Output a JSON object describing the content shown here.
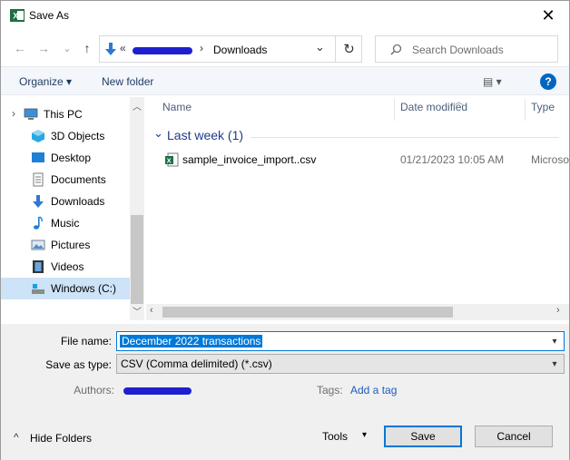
{
  "window": {
    "title": "Save As",
    "close_glyph": "✕",
    "app_icon": "excel-icon"
  },
  "nav_buttons": {
    "back": "←",
    "forward": "→",
    "recent": "⌄",
    "up": "↑"
  },
  "address": {
    "prefix": "«",
    "current_folder": "Downloads",
    "separator": "›",
    "refresh_glyph": "↻",
    "chevron": "⌄"
  },
  "search": {
    "placeholder": "Search Downloads"
  },
  "toolbar": {
    "organize": "Organize ▾",
    "new_folder": "New folder",
    "view_glyph": "▤ ▾",
    "help": "?"
  },
  "sidebar": {
    "items": [
      {
        "label": "This PC",
        "icon": "pc-icon",
        "indent": 0
      },
      {
        "label": "3D Objects",
        "icon": "cube-icon",
        "indent": 1
      },
      {
        "label": "Desktop",
        "icon": "desktop-icon",
        "indent": 1
      },
      {
        "label": "Documents",
        "icon": "document-icon",
        "indent": 1
      },
      {
        "label": "Downloads",
        "icon": "download-icon",
        "indent": 1
      },
      {
        "label": "Music",
        "icon": "music-icon",
        "indent": 1
      },
      {
        "label": "Pictures",
        "icon": "picture-icon",
        "indent": 1
      },
      {
        "label": "Videos",
        "icon": "video-icon",
        "indent": 1
      },
      {
        "label": "Windows (C:)",
        "icon": "drive-icon",
        "indent": 1,
        "selected": true
      }
    ],
    "expand_glyph": "›"
  },
  "columns": [
    "Name",
    "Date modified",
    "Type"
  ],
  "group": {
    "label": "Last week (1)",
    "collapse_glyph": "⌄"
  },
  "files": [
    {
      "name": "sample_invoice_import..csv",
      "date": "01/21/2023 10:05 AM",
      "type": "Microso",
      "icon": "excel-csv-icon"
    }
  ],
  "form": {
    "file_name_label": "File name:",
    "file_name_value": "December 2022 transactions",
    "save_type_label": "Save as type:",
    "save_type_value": "CSV (Comma delimited) (*.csv)",
    "authors_label": "Authors:",
    "tags_label": "Tags:",
    "tags_placeholder": "Add a tag"
  },
  "footer": {
    "hide_folders": "Hide Folders",
    "hide_glyph": "^",
    "tools": "Tools",
    "tools_glyph": "▾",
    "save": "Save",
    "cancel": "Cancel"
  },
  "colors": {
    "accent": "#0078d7",
    "selected_bg": "#cde3f7",
    "link": "#1e5bbf",
    "group_header": "#1e3a8a"
  }
}
